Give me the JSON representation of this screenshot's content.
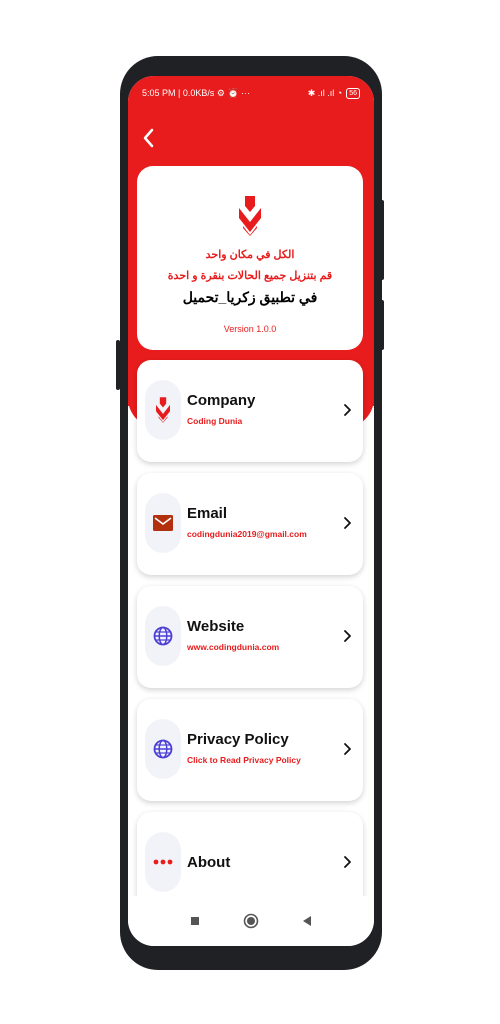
{
  "status_bar": {
    "time_speed": "5:05 PM | 0.0KB/s",
    "extras": "⚙ ⏰ ···",
    "signal": "✱ .ıl .ıl ◔",
    "battery": "56"
  },
  "header": {
    "arabic_line_1": "الكل في مكان واحد",
    "arabic_line_2": "قم بتنزيل جميع الحالات بنقرة و احدة",
    "arabic_line_3": "في تطبيق زكريا_تحميل",
    "version": "Version 1.0.0"
  },
  "items": [
    {
      "title": "Company",
      "subtitle": "Coding Dunia",
      "icon": "brand-logo-icon"
    },
    {
      "title": "Email",
      "subtitle": "codingdunia2019@gmail.com",
      "icon": "mail-icon"
    },
    {
      "title": "Website",
      "subtitle": "www.codingdunia.com",
      "icon": "globe-icon"
    },
    {
      "title": "Privacy Policy",
      "subtitle": "Click to Read Privacy Policy",
      "icon": "globe-icon"
    },
    {
      "title": "About",
      "subtitle": "",
      "icon": "more-dots-icon"
    }
  ],
  "colors": {
    "accent": "#e81c1c",
    "icon_purple": "#4b3fd6",
    "mail_brown": "#b3300e"
  }
}
